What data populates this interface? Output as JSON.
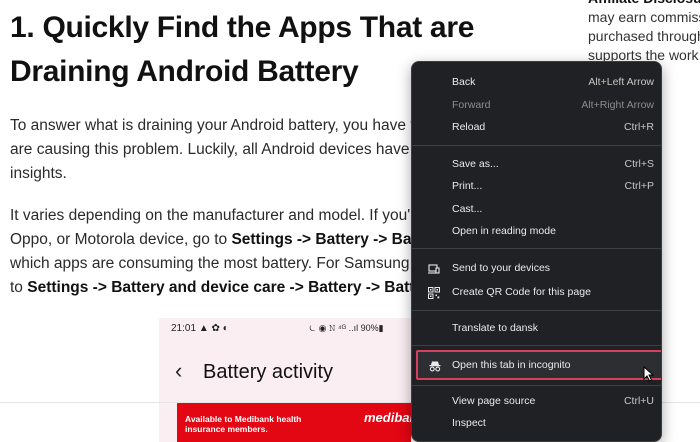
{
  "article": {
    "heading": "1. Quickly Find the Apps That are Draining Android Battery",
    "p1_a": "To answer what is draining your Android battery, you have to c",
    "p1_b": "are causing this problem. Luckily, all Android devices have ba",
    "p1_c": "insights.",
    "p2_a": "It varies depending on the manufacturer and model. If you're",
    "p2_b_pre": "Oppo, or Motorola device, go to ",
    "p2_b_bold": "Settings -> Battery -> Batt",
    "p2_c": "which apps are consuming the most battery. For Samsung Ga",
    "p2_d_pre": "to ",
    "p2_d_bold": "Settings -> Battery and device care -> Battery -> Batte"
  },
  "sidebar": {
    "title": "Affiliate Disclosu",
    "line1": "may earn commiss",
    "line2": "purchased through",
    "line3": "supports the work w"
  },
  "phone": {
    "time": "21:01",
    "status_icons": "▲ ✿ ◐",
    "status_right": "⏾ ◉ 𝙽 ⁴ᴳ ..ıl 90%▮",
    "back": "‹",
    "title": "Battery activity"
  },
  "ad": {
    "text": "Available to Medibank health insurance members.",
    "brand": "medibank Live Bet"
  },
  "menu": {
    "items": [
      {
        "label": "Back",
        "shortcut": "Alt+Left Arrow"
      },
      {
        "label": "Forward",
        "shortcut": "Alt+Right Arrow"
      },
      {
        "label": "Reload",
        "shortcut": "Ctrl+R"
      },
      {
        "label": "Save as...",
        "shortcut": "Ctrl+S"
      },
      {
        "label": "Print...",
        "shortcut": "Ctrl+P"
      },
      {
        "label": "Cast...",
        "shortcut": ""
      },
      {
        "label": "Open in reading mode",
        "shortcut": ""
      },
      {
        "label": "Send to your devices",
        "shortcut": ""
      },
      {
        "label": "Create QR Code for this page",
        "shortcut": ""
      },
      {
        "label": "Translate to dansk",
        "shortcut": ""
      },
      {
        "label": "Open this tab in incognito",
        "shortcut": ""
      },
      {
        "label": "View page source",
        "shortcut": "Ctrl+U"
      },
      {
        "label": "Inspect",
        "shortcut": ""
      }
    ],
    "highlight_color": "#d6405c"
  }
}
